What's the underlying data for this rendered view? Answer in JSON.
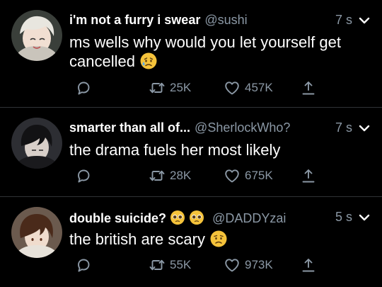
{
  "tweets": [
    {
      "name": "i'm not a furry i swear",
      "handle": "@sushi",
      "time": "7 s",
      "text_lines": [
        "ms wells why would you let yourself get",
        "cancelled"
      ],
      "emoji": "sad-sweat-face-emoji",
      "retweets": "25K",
      "likes": "457K"
    },
    {
      "name": "smarter than all of...",
      "handle": "@SherlockWho?",
      "time": "7 s",
      "text_lines": [
        "the drama fuels her most likely"
      ],
      "retweets": "28K",
      "likes": "675K"
    },
    {
      "name": "double suicide?",
      "name_emoji": "pleading-face-emoji",
      "handle": "@DADDYzai",
      "time": "5 s",
      "text_lines": [
        "the british are scary"
      ],
      "emoji": "worried-face-emoji",
      "retweets": "55K",
      "likes": "973K"
    }
  ],
  "colors": {
    "background": "#000000",
    "text": "#ffffff",
    "muted": "#8b98a5",
    "separator": "#2f3336"
  },
  "icons": [
    "reply-icon",
    "retweet-icon",
    "like-icon",
    "share-icon",
    "chevron-down-icon"
  ]
}
